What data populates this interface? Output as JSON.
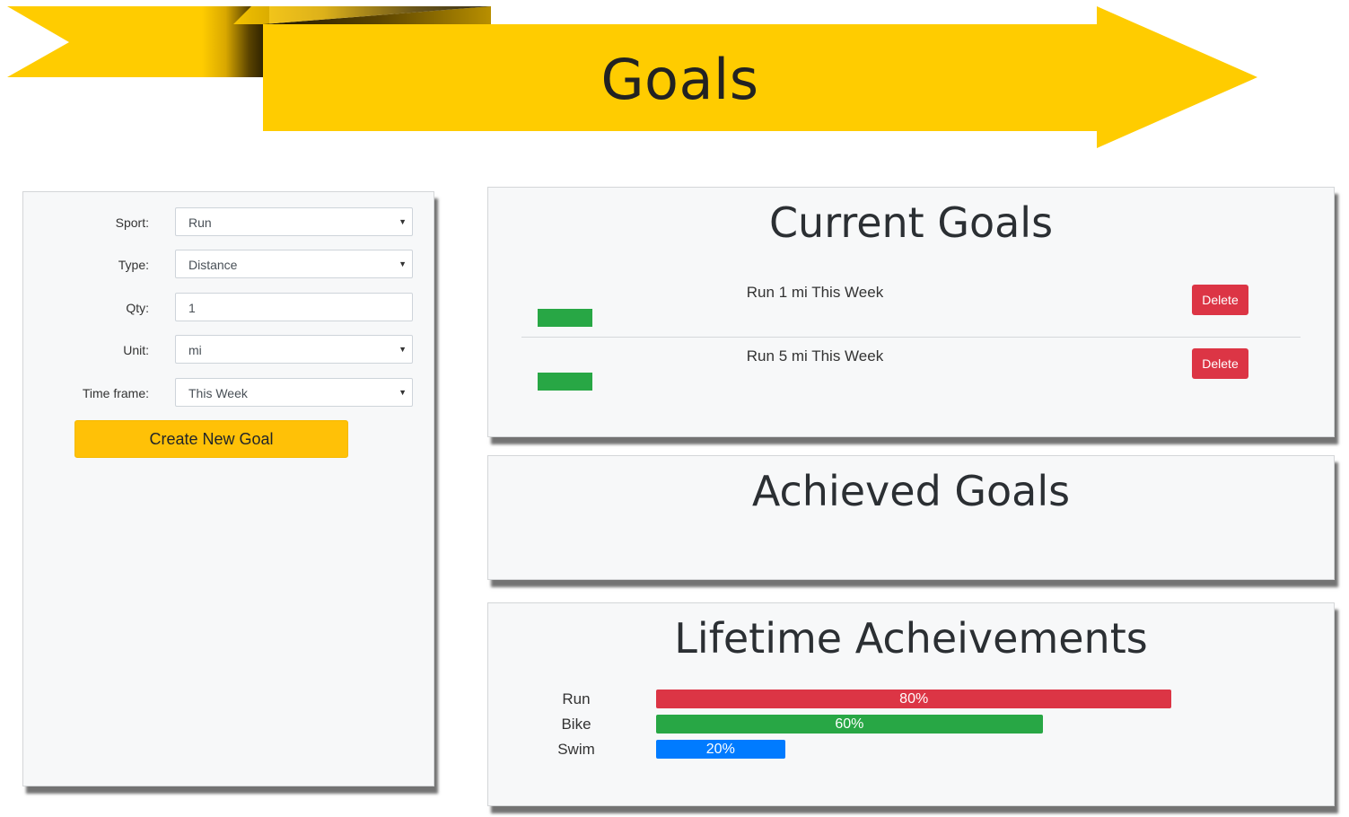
{
  "header": {
    "title": "Goals"
  },
  "form": {
    "sport": {
      "label": "Sport:",
      "value": "Run"
    },
    "type": {
      "label": "Type:",
      "value": "Distance"
    },
    "qty": {
      "label": "Qty:",
      "value": "1"
    },
    "unit": {
      "label": "Unit:",
      "value": "mi"
    },
    "timeframe": {
      "label": "Time frame:",
      "value": "This Week"
    },
    "create_label": "Create New Goal"
  },
  "current_goals": {
    "title": "Current Goals",
    "items": [
      {
        "text": "Run 1 mi This Week",
        "delete_label": "Delete"
      },
      {
        "text": "Run 5 mi This Week",
        "delete_label": "Delete"
      }
    ]
  },
  "achieved_goals": {
    "title": "Achieved Goals"
  },
  "lifetime": {
    "title": "Lifetime Acheivements",
    "items": [
      {
        "label": "Run",
        "percent": 80,
        "percent_label": "80%",
        "color": "#dc3545"
      },
      {
        "label": "Bike",
        "percent": 60,
        "percent_label": "60%",
        "color": "#28a745"
      },
      {
        "label": "Swim",
        "percent": 20,
        "percent_label": "20%",
        "color": "#007bff"
      }
    ]
  },
  "colors": {
    "banner": "#ffcc00",
    "accent": "#ffc107",
    "danger": "#dc3545",
    "success": "#28a745",
    "primary": "#007bff"
  }
}
